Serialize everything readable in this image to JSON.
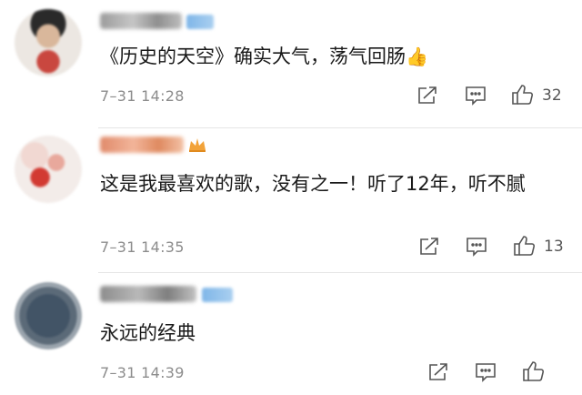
{
  "comments": [
    {
      "text": "《历史的天空》确实大气，荡气回肠",
      "emoji": "👍",
      "time": "7–31 14:28",
      "likes": "32"
    },
    {
      "text": "这是我最喜欢的歌，没有之一！听了12年，听不腻",
      "time": "7–31 14:35",
      "likes": "13"
    },
    {
      "text": "永远的经典",
      "time": "7–31 14:39",
      "likes": ""
    }
  ],
  "icons": {
    "share": "share-icon",
    "comment": "comment-icon",
    "like": "thumbs-up-icon",
    "badge": "vip-badge-icon",
    "crown": "crown-icon"
  },
  "colors": {
    "text": "#1a1a1a",
    "muted": "#8c8c8c",
    "divider": "#e6e6e6"
  }
}
